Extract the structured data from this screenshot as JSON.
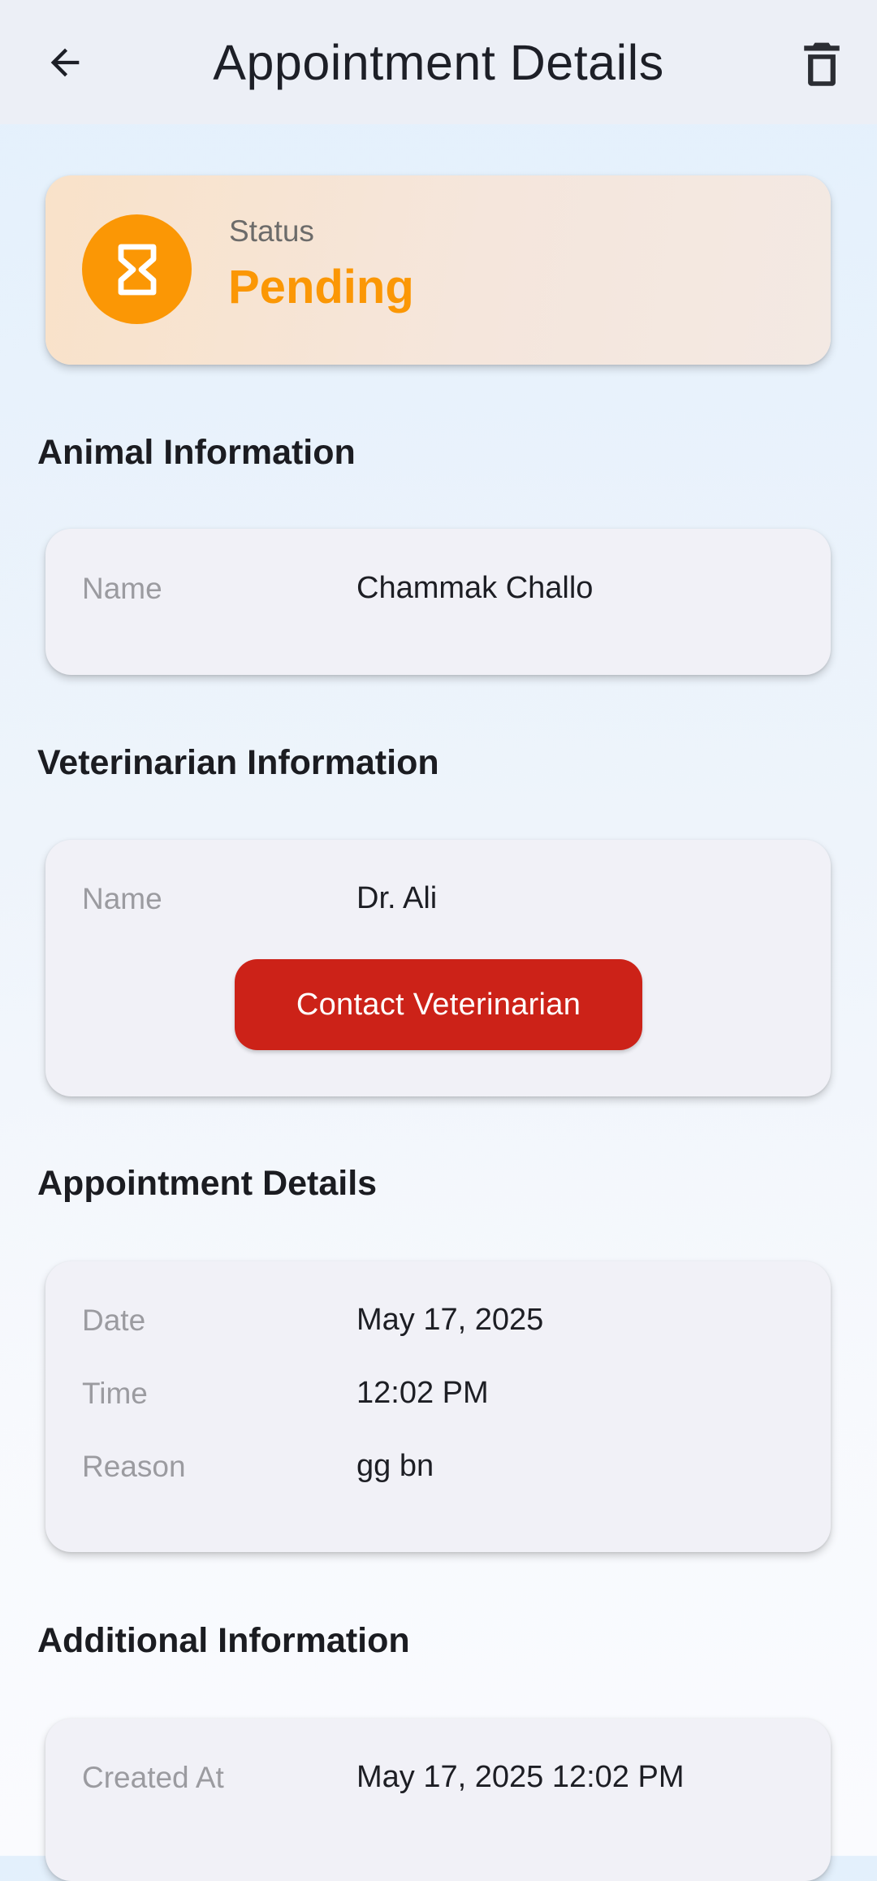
{
  "appbar": {
    "title": "Appointment Details",
    "back_icon": "arrow-back-icon",
    "delete_icon": "trash-icon"
  },
  "status": {
    "caption": "Status",
    "value": "Pending",
    "icon": "hourglass-icon",
    "accent_color": "#fb9705"
  },
  "animal": {
    "section_title": "Animal Information",
    "name_label": "Name",
    "name_value": "Chammak Challo"
  },
  "vet": {
    "section_title": "Veterinarian Information",
    "name_label": "Name",
    "name_value": "Dr. Ali",
    "contact_label": "Contact Veterinarian",
    "contact_color": "#cc2218"
  },
  "appointment": {
    "section_title": "Appointment Details",
    "date_label": "Date",
    "date_value": "May 17, 2025",
    "time_label": "Time",
    "time_value": "12:02 PM",
    "reason_label": "Reason",
    "reason_value": "gg bn"
  },
  "additional": {
    "section_title": "Additional Information",
    "created_label": "Created At",
    "created_value": "May 17, 2025 12:02 PM"
  }
}
